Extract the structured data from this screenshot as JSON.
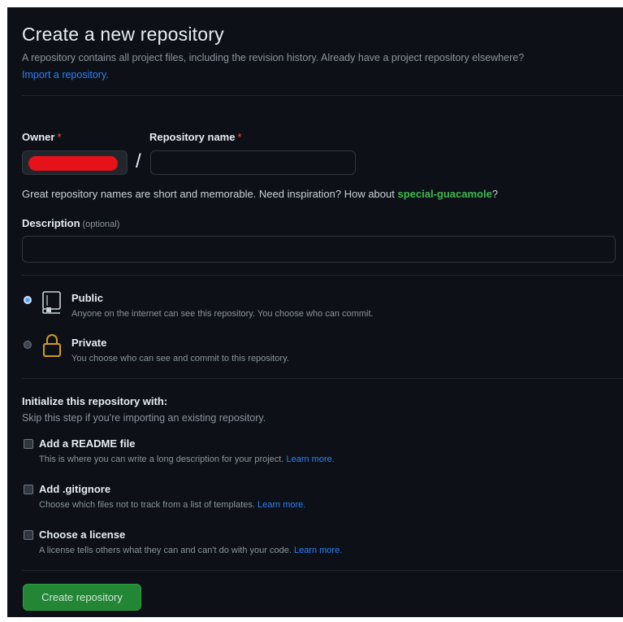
{
  "header": {
    "title": "Create a new repository",
    "subtitle": "A repository contains all project files, including the revision history. Already have a project repository elsewhere?",
    "import_link": "Import a repository."
  },
  "form": {
    "owner": {
      "label": "Owner",
      "required_mark": "*",
      "value": ""
    },
    "separator": "/",
    "repo_name": {
      "label": "Repository name",
      "required_mark": "*",
      "value": "",
      "placeholder": ""
    },
    "hint": {
      "prefix": "Great repository names are short and memorable. Need inspiration? How about ",
      "suggestion": "special-guacamole",
      "suffix": "?"
    },
    "description": {
      "label": "Description",
      "optional_note": "(optional)",
      "value": "",
      "placeholder": ""
    }
  },
  "visibility": {
    "selected": "public",
    "options": [
      {
        "id": "public",
        "title": "Public",
        "description": "Anyone on the internet can see this repository. You choose who can commit.",
        "icon": "repo-icon"
      },
      {
        "id": "private",
        "title": "Private",
        "description": "You choose who can see and commit to this repository.",
        "icon": "lock-icon"
      }
    ]
  },
  "initialize": {
    "heading": "Initialize this repository with:",
    "subheading": "Skip this step if you're importing an existing repository.",
    "options": [
      {
        "title": "Add a README file",
        "description": "This is where you can write a long description for your project.",
        "link": "Learn more.",
        "checked": false
      },
      {
        "title": "Add .gitignore",
        "description": "Choose which files not to track from a list of templates.",
        "link": "Learn more.",
        "checked": false
      },
      {
        "title": "Choose a license",
        "description": "A license tells others what they can and can't do with your code.",
        "link": "Learn more.",
        "checked": false
      }
    ]
  },
  "actions": {
    "create_label": "Create repository"
  },
  "colors": {
    "background": "#0d1117",
    "accent_green": "#238636",
    "link_blue": "#2f81f7",
    "suggestion_green": "#3fb950",
    "required_red": "#f85149",
    "lock_icon": "#d29922"
  }
}
